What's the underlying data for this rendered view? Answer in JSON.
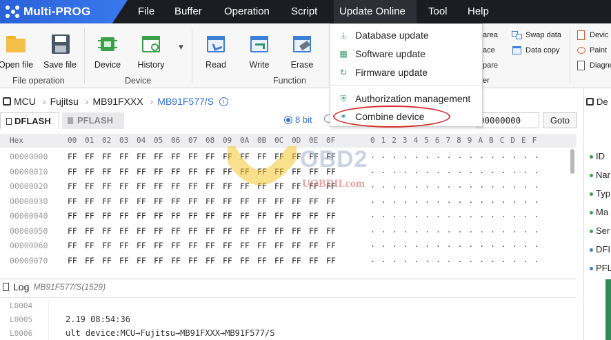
{
  "app": {
    "logo_text": "Multi-PROG"
  },
  "menubar": [
    "File",
    "Buffer",
    "Operation",
    "Script",
    "Update Online",
    "Tool",
    "Help"
  ],
  "ribbon": {
    "file_operation": {
      "label": "File operation",
      "open_file": "Open file",
      "save_file": "Save file"
    },
    "device": {
      "label": "Device",
      "device": "Device",
      "history": "History"
    },
    "function": {
      "label": "Function",
      "read": "Read",
      "write": "Write",
      "erase": "Erase"
    },
    "partial": {
      "area": "area",
      "ace": "ace",
      "pare": "pare",
      "er": "er",
      "swap_data": "Swap data",
      "data_copy": "Data copy",
      "devic": "Devic",
      "paint": "Paint",
      "diagno": "Diagno"
    }
  },
  "update_menu": {
    "items": [
      "Database update",
      "Software update",
      "Firmware update",
      "Authorization management",
      "Combine device"
    ],
    "highlighted": "Combine device"
  },
  "breadcrumb": [
    "MCU",
    "Fujitsu",
    "MB91FXXX",
    "MB91F577/S"
  ],
  "tabs": {
    "dflash": "DFLASH",
    "pflash": "PFLASH"
  },
  "view_mode": {
    "bit8": "8 bit"
  },
  "goto": {
    "address_value": "00000000",
    "button": "Goto"
  },
  "hex_view": {
    "header_label": "Hex",
    "columns": [
      "00",
      "01",
      "02",
      "03",
      "04",
      "05",
      "06",
      "07",
      "08",
      "09",
      "0A",
      "0B",
      "0C",
      "0D",
      "0E",
      "0F"
    ],
    "ascii_header": "0 1 2 3 4 5 6 7 8 9 A B C D E F",
    "rows": [
      {
        "addr": "00000000",
        "byte": "FF"
      },
      {
        "addr": "00000010",
        "byte": "FF"
      },
      {
        "addr": "00000020",
        "byte": "FF"
      },
      {
        "addr": "00000030",
        "byte": "FF"
      },
      {
        "addr": "00000040",
        "byte": "FF"
      },
      {
        "addr": "00000050",
        "byte": "FF"
      },
      {
        "addr": "00000060",
        "byte": "FF"
      },
      {
        "addr": "00000070",
        "byte": "FF"
      }
    ],
    "ascii_fill": "................"
  },
  "right_panel": {
    "title": "De",
    "fields": [
      "ID",
      "Nar",
      "Typ",
      "Ma",
      "Ser",
      "DFI",
      "PFL"
    ]
  },
  "log": {
    "title": "Log",
    "subtitle": "MB91F577/S(1529)",
    "lines": [
      {
        "num": "L0004",
        "text": ""
      },
      {
        "num": "L0005",
        "text": "2.19 08:54:36"
      },
      {
        "num": "L0006",
        "text": "ult device:MCU→Fujitsu→MB91FXXX→MB91F577/S"
      }
    ]
  },
  "watermark": {
    "brand": "OBD2",
    "site": "UOBDII.com"
  },
  "colors": {
    "accent": "#2f6fd8",
    "logo": "#2a62d8",
    "highlight_oval": "#d5302f",
    "menubar": "#1b1d22"
  }
}
